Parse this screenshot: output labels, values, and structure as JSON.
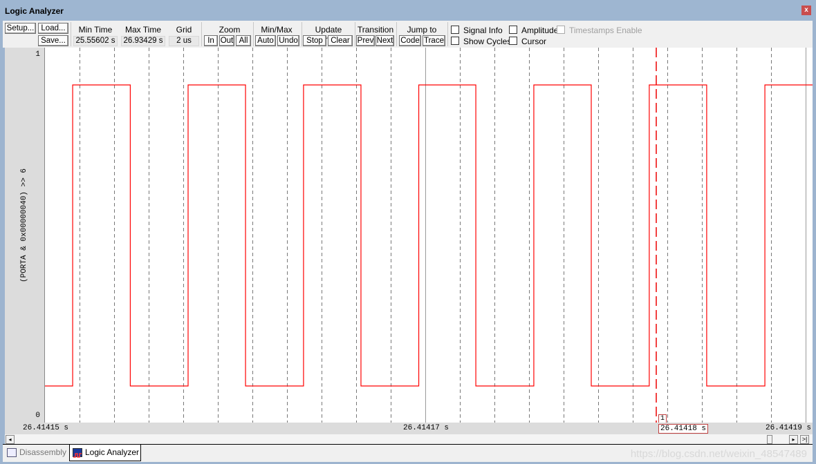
{
  "window": {
    "title": "Logic Analyzer",
    "close_label": "x"
  },
  "toolbar": {
    "setup": "Setup...",
    "load": "Load...",
    "save": "Save...",
    "min_time_label": "Min Time",
    "min_time": "25.55602 s",
    "max_time_label": "Max Time",
    "max_time": "26.93429 s",
    "grid_label": "Grid",
    "grid": "2 us",
    "zoom_label": "Zoom",
    "zoom_in": "In",
    "zoom_out": "Out",
    "zoom_all": "All",
    "minmax_label": "Min/Max",
    "auto": "Auto",
    "undo": "Undo",
    "update_label": "Update Screen",
    "stop": "Stop",
    "clear": "Clear",
    "transition_label": "Transition",
    "prev": "Prev",
    "next": "Next",
    "jump_label": "Jump to",
    "code": "Code",
    "trace": "Trace",
    "signal_info": "Signal Info",
    "show_cycles": "Show Cycles",
    "amplitude": "Amplitude",
    "cursor": "Cursor",
    "timestamps": "Timestamps Enable",
    "checkboxes": {
      "signal_info": false,
      "show_cycles": false,
      "amplitude": false,
      "cursor": false,
      "timestamps": false
    }
  },
  "signal": {
    "name": "(PORTA & 0x00000040) >> 6",
    "y_max": "1",
    "y_min": "0",
    "color": "#ff0000",
    "transitions_us": [
      0.73,
      3.76,
      6.8,
      9.82,
      12.87,
      15.89,
      18.93,
      21.93,
      24.98,
      28.0,
      31.05,
      34.07,
      37.13,
      40.13
    ],
    "initial_level": 0
  },
  "axis": {
    "t_start": "26.41415 s",
    "t_mid": "26.41417 s",
    "t_end": "26.41419 s",
    "cursor_time": "26.41418 s",
    "cursor_label": "1"
  },
  "tabs": [
    {
      "label": "Disassembly",
      "active": false
    },
    {
      "label": "Logic Analyzer",
      "active": true
    }
  ],
  "watermark": "https://blog.csdn.net/weixin_48547489"
}
